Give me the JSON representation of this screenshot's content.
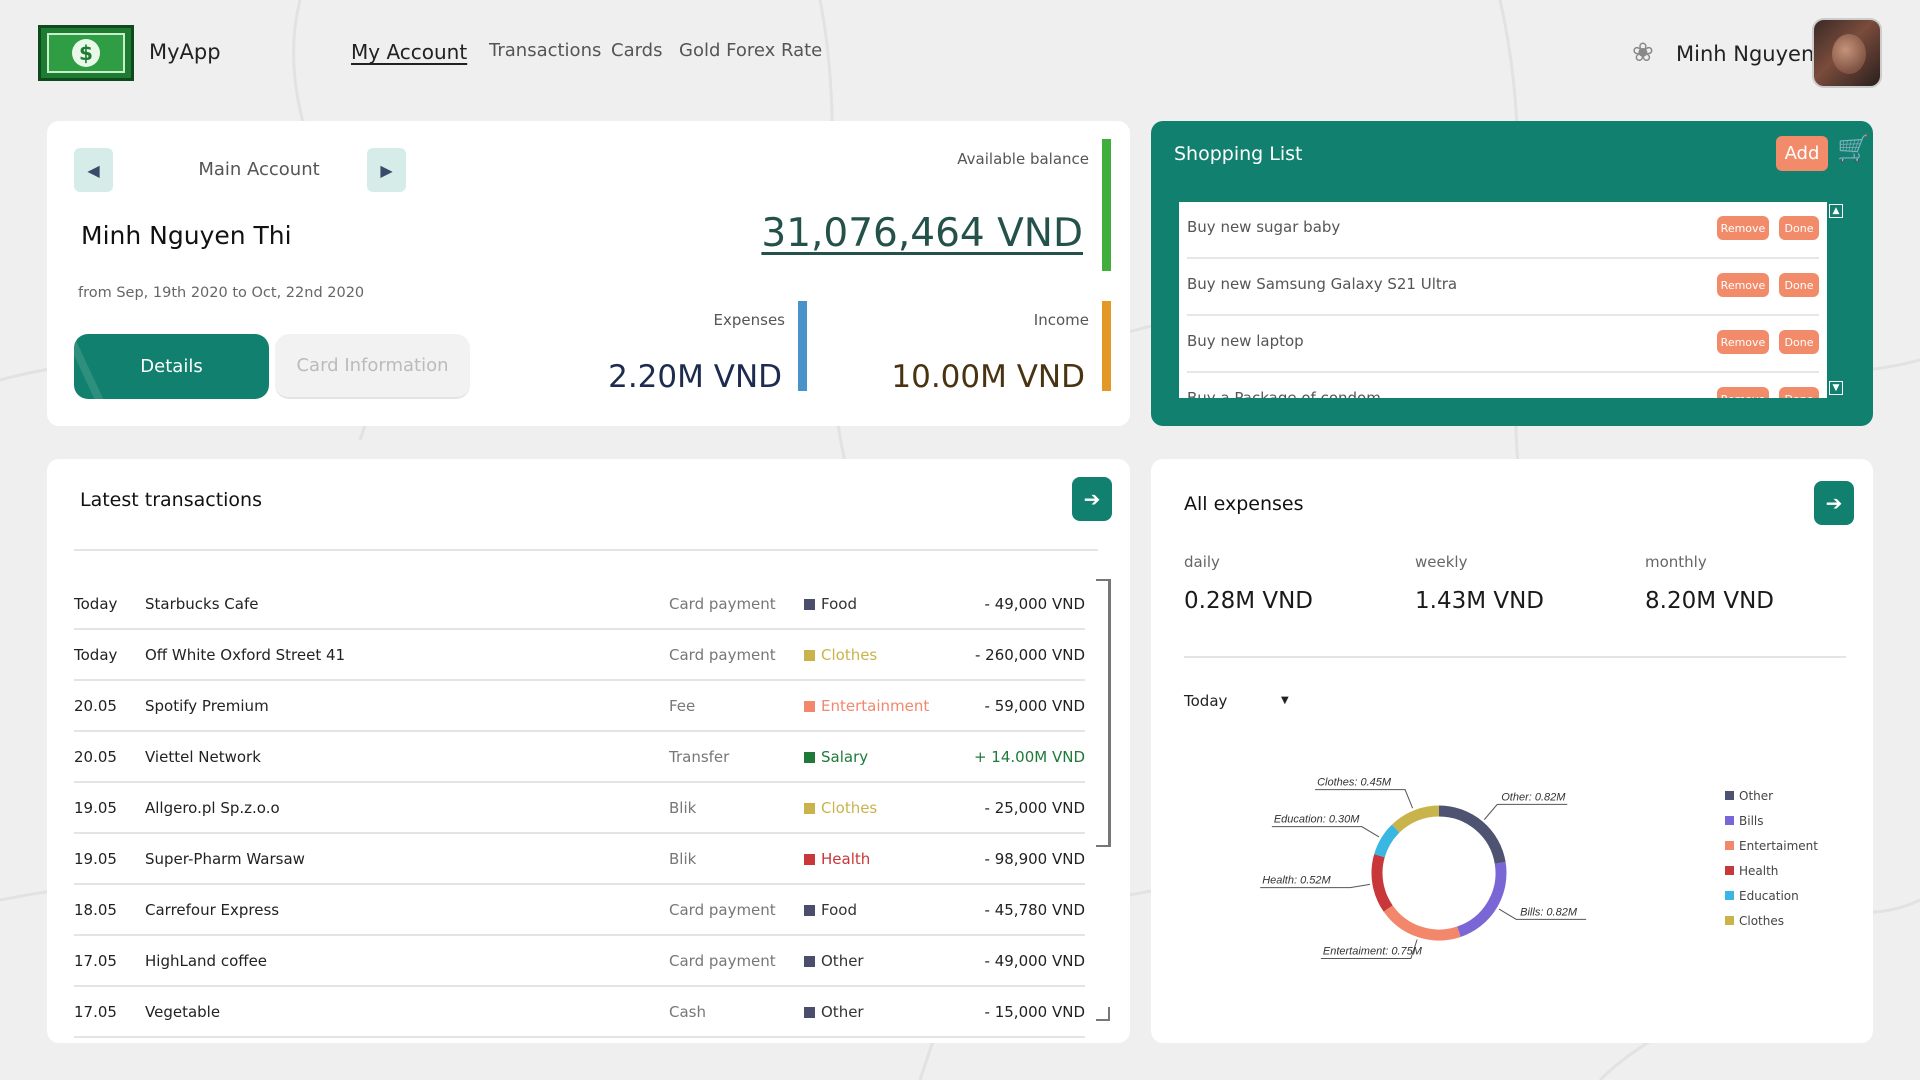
{
  "app": {
    "name": "MyApp"
  },
  "nav": [
    {
      "label": "My Account",
      "active": true
    },
    {
      "label": "Transactions",
      "active": false
    },
    {
      "label": "Cards",
      "active": false
    },
    {
      "label": "Gold Forex Rate",
      "active": false
    }
  ],
  "user": {
    "name": "Minh Nguyen"
  },
  "account": {
    "title": "Main Account",
    "owner": "Minh Nguyen Thi",
    "period": "from Sep, 19th 2020 to Oct, 22nd 2020",
    "details_label": "Details",
    "card_info_label": "Card Information",
    "available_label": "Available balance",
    "available_value": "31,076,464 VND",
    "expenses_label": "Expenses",
    "expenses_value": "2.20M VND",
    "income_label": "Income",
    "income_value": "10.00M VND",
    "colors": {
      "balance": "#3fae3a",
      "expenses": "#4a93c9",
      "income": "#e39a25"
    }
  },
  "shopping": {
    "title": "Shopping List",
    "add_label": "Add",
    "remove_label": "Remove",
    "done_label": "Done",
    "items": [
      "Buy new sugar baby",
      "Buy new Samsung Galaxy S21 Ultra",
      "Buy new laptop",
      "Buy a Package of condom"
    ]
  },
  "transactions": {
    "title": "Latest transactions",
    "rows": [
      {
        "date": "Today",
        "name": "Starbucks Cafe",
        "method": "Card payment",
        "category": "Food",
        "color": "#4a4e6a",
        "amount": "- 49,000 VND"
      },
      {
        "date": "Today",
        "name": "Off White Oxford Street 41",
        "method": "Card payment",
        "category": "Clothes",
        "color": "#c9b44c",
        "amount": "- 260,000 VND"
      },
      {
        "date": "20.05",
        "name": "Spotify Premium",
        "method": "Fee",
        "category": "Entertainment",
        "color": "#f2876c",
        "amount": "- 59,000 VND"
      },
      {
        "date": "20.05",
        "name": "Viettel Network",
        "method": "Transfer",
        "category": "Salary",
        "color": "#1f7a3a",
        "amount": "+ 14.00M VND"
      },
      {
        "date": "19.05",
        "name": "Allgero.pl Sp.z.o.o",
        "method": "Blik",
        "category": "Clothes",
        "color": "#c9b44c",
        "amount": "- 25,000 VND"
      },
      {
        "date": "19.05",
        "name": "Super-Pharm Warsaw",
        "method": "Blik",
        "category": "Health",
        "color": "#c8373a",
        "amount": "- 98,900 VND"
      },
      {
        "date": "18.05",
        "name": "Carrefour Express",
        "method": "Card payment",
        "category": "Food",
        "color": "#4a4e6a",
        "amount": "- 45,780 VND"
      },
      {
        "date": "17.05",
        "name": "HighLand coffee",
        "method": "Card payment",
        "category": "Other",
        "color": "#4a4e6a",
        "amount": "- 49,000 VND"
      },
      {
        "date": "17.05",
        "name": "Vegetable",
        "method": "Cash",
        "category": "Other",
        "color": "#4a4e6a",
        "amount": "- 15,000 VND"
      }
    ]
  },
  "expenses": {
    "title": "All expenses",
    "periods": [
      {
        "label": "daily",
        "value": "0.28M VND"
      },
      {
        "label": "weekly",
        "value": "1.43M VND"
      },
      {
        "label": "monthly",
        "value": "8.20M VND"
      }
    ],
    "range": "Today"
  },
  "chart_data": {
    "type": "pie",
    "variant": "donut",
    "unit": "M",
    "slices": [
      {
        "name": "Other",
        "value": 0.82,
        "label": "Other: 0.82M",
        "color": "#4d5370"
      },
      {
        "name": "Bills",
        "value": 0.82,
        "label": "Bills: 0.82M",
        "color": "#7b66d6"
      },
      {
        "name": "Entertaiment",
        "value": 0.75,
        "label": "Entertaiment: 0.75M",
        "color": "#f2876c"
      },
      {
        "name": "Health",
        "value": 0.52,
        "label": "Health: 0.52M",
        "color": "#c8373a"
      },
      {
        "name": "Education",
        "value": 0.3,
        "label": "Education: 0.30M",
        "color": "#3ab6e3"
      },
      {
        "name": "Clothes",
        "value": 0.45,
        "label": "Clothes: 0.45M",
        "color": "#c9b44c"
      }
    ],
    "legend": [
      "Other",
      "Bills",
      "Entertaiment",
      "Health",
      "Education",
      "Clothes"
    ],
    "legend_position": "right"
  }
}
